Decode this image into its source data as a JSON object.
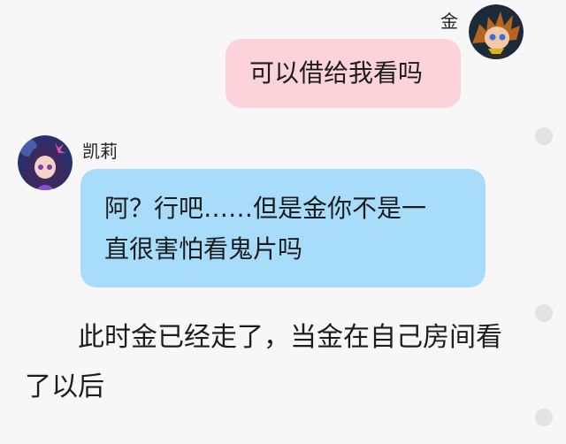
{
  "messages": [
    {
      "sender": "金",
      "side": "right",
      "text": "可以借给我看吗",
      "bubble_color": "#fcd3da"
    },
    {
      "sender": "凯莉",
      "side": "left",
      "lines": [
        "阿？行吧……但是金你不是一",
        "直很害怕看鬼片吗"
      ],
      "bubble_color": "#a8dcfb"
    }
  ],
  "narration": {
    "lines": [
      "　　此时金已经走了，当金在自己房间看",
      "了以后"
    ]
  },
  "icons": {
    "kim_avatar": "boy-anime-avatar-icon",
    "kelly_avatar": "girl-anime-avatar-icon"
  }
}
